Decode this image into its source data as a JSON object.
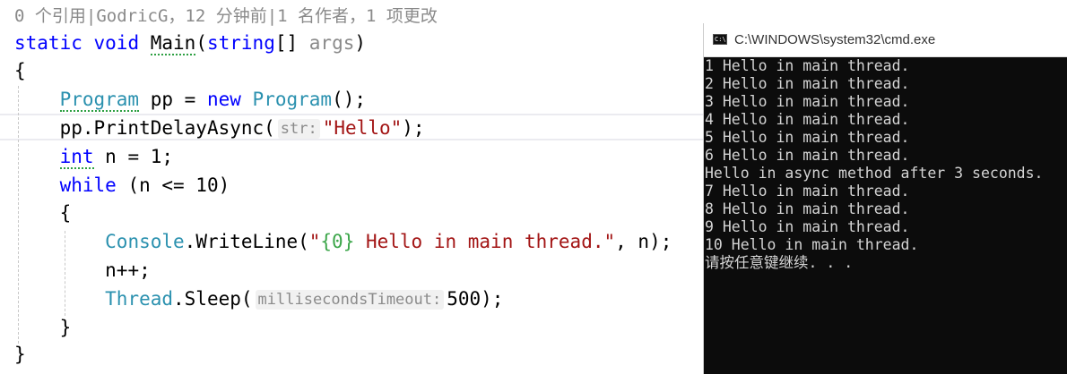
{
  "codelens": {
    "text": "0 个引用|GodricG，12 分钟前|1 名作者，1 项更改"
  },
  "code": {
    "l2": {
      "kw1": "static",
      "kw2": "void",
      "method": "Main",
      "p1": "(",
      "type": "string",
      "p2": "[] ",
      "param": "args",
      "p3": ")"
    },
    "l3": {
      "text": "{"
    },
    "l4": {
      "type1": "Program",
      "plain1": " pp = ",
      "kw": "new",
      "plain2": " ",
      "type2": "Program",
      "plain3": "();"
    },
    "l5": {
      "plain1": "pp.PrintDelayAsync(",
      "hint": "str:",
      "str": "\"Hello\"",
      "plain2": ");"
    },
    "l6": {
      "kw": "int",
      "plain": " n = 1;"
    },
    "l7": {
      "kw": "while",
      "plain": " (n <= 10)"
    },
    "l8": {
      "text": "{"
    },
    "l9": {
      "type": "Console",
      "plain1": ".WriteLine(",
      "q1": "\"",
      "fmt": "{0}",
      "str": " Hello in main thread.\"",
      "plain2": ", n);"
    },
    "l10": {
      "text": "n++;"
    },
    "l11": {
      "type": "Thread",
      "plain1": ".Sleep(",
      "hint": "millisecondsTimeout:",
      "plain2": "500);"
    },
    "l12": {
      "text": "}"
    },
    "l13": {
      "text": "}"
    }
  },
  "console": {
    "title": "C:\\WINDOWS\\system32\\cmd.exe",
    "icon": "cmd-window-icon",
    "icon_glyph": "C:\\",
    "lines": [
      "1 Hello in main thread.",
      "2 Hello in main thread.",
      "3 Hello in main thread.",
      "4 Hello in main thread.",
      "5 Hello in main thread.",
      "6 Hello in main thread.",
      "Hello in async method after 3 seconds.",
      "7 Hello in main thread.",
      "8 Hello in main thread.",
      "9 Hello in main thread.",
      "10 Hello in main thread.",
      "请按任意键继续. . ."
    ]
  },
  "colors": {
    "keyword": "#0000ff",
    "type": "#2b91af",
    "string": "#a31515",
    "format_item": "#3ca64a",
    "console_bg": "#0c0c0c",
    "console_fg": "#d4d4d4"
  }
}
